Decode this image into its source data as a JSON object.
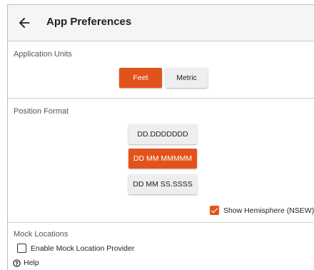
{
  "header": {
    "title": "App Preferences",
    "back_icon": "arrow-left-icon"
  },
  "units": {
    "label": "Application Units",
    "options": [
      "Feet",
      "Metric"
    ],
    "selected": "Feet"
  },
  "position": {
    "label": "Position Format",
    "options": [
      "DD.DDDDDDD",
      "DD MM MMMMM",
      "DD MM SS.SSSS"
    ],
    "selected": "DD MM MMMMM",
    "hemisphere_label": "Show Hemisphere (NSEW)",
    "hemisphere_checked": true
  },
  "mock": {
    "label": "Mock Locations",
    "enable_label": "Enable Mock Location Provider",
    "enable_checked": false,
    "help_label": "Help",
    "help_icon": "help-circle-icon"
  },
  "colors": {
    "accent": "#e2531b",
    "appbar_bg": "#f5f5f5"
  }
}
